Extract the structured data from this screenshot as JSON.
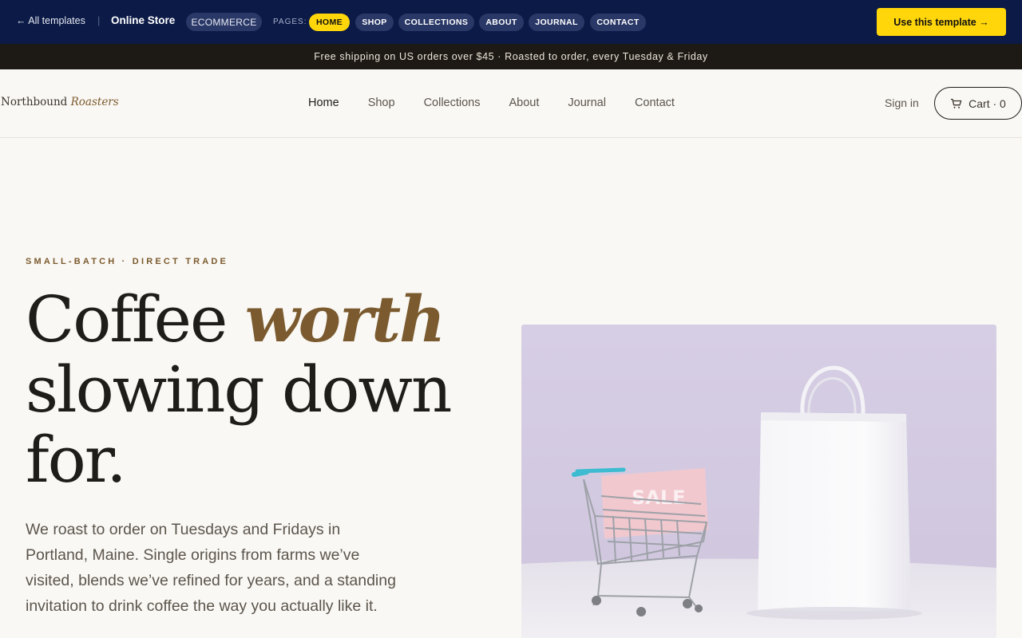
{
  "template_bar": {
    "back_label": "← All templates",
    "store_name": "Online Store",
    "category": "ECOMMERCE",
    "pages_label": "PAGES:",
    "pages": [
      "HOME",
      "SHOP",
      "COLLECTIONS",
      "ABOUT",
      "JOURNAL",
      "CONTACT"
    ],
    "active_page": "HOME",
    "cta_label": "Use this template →"
  },
  "announcement": "Free shipping on US orders over $45 · Roasted to order, every Tuesday & Friday",
  "site": {
    "brand_main": "Northbound",
    "brand_accent": "Roasters",
    "nav": [
      "Home",
      "Shop",
      "Collections",
      "About",
      "Journal",
      "Contact"
    ],
    "active_nav": "Home",
    "sign_in": "Sign in",
    "cart_label": "Cart · 0"
  },
  "hero": {
    "eyebrow": "SMALL-BATCH · DIRECT TRADE",
    "headline_part1": "Coffee ",
    "headline_accent": "worth",
    "headline_line2": "slowing down",
    "headline_line3": "for.",
    "body": "We roast to order on Tuesdays and Fridays in Portland, Maine. Single origins from farms we’ve visited, blends we’ve refined for years, and a standing invitation to drink coffee the way you actually like it.",
    "image_sign_text": "SALE"
  },
  "colors": {
    "topbar_bg": "#0b1a46",
    "accent_yellow": "#ffd60a",
    "announce_bg": "#1d1a16",
    "brand_brown": "#7a5a2e",
    "page_bg": "#faf8f4",
    "image_bg": "#d8d0e6"
  }
}
